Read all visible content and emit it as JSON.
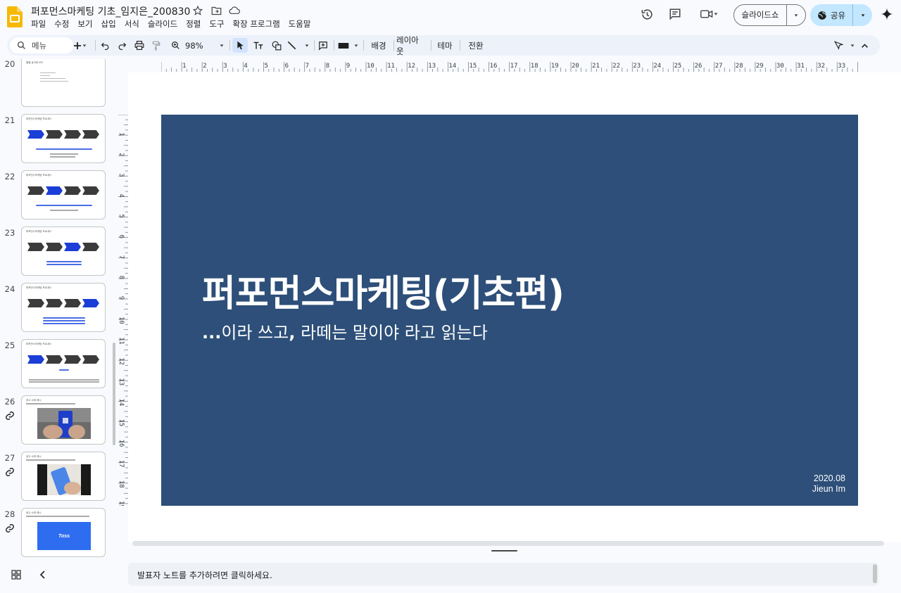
{
  "app": {
    "doc_title": "퍼포먼스마케팅 기초_임지은_200830",
    "menu": [
      "파일",
      "수정",
      "보기",
      "삽입",
      "서식",
      "슬라이드",
      "정렬",
      "도구",
      "확장 프로그램",
      "도움말"
    ],
    "slideshow_label": "슬라이드쇼",
    "share_label": "공유",
    "brand_color": "#f6b900",
    "share_color": "#c2e7ff"
  },
  "toolbar": {
    "search_label": "메뉴",
    "zoom": "98%",
    "background_label": "배경",
    "layout_label": "레이아웃",
    "theme_label": "테마",
    "transition_label": "전환"
  },
  "filmstrip": {
    "numbers": [
      "20",
      "21",
      "22",
      "23",
      "24",
      "25",
      "26",
      "27",
      "28"
    ],
    "thumb_title_20": "월별 광고비 KPI",
    "thumb_title_21": "퍼포먼스마케팅 프로세스",
    "thumb_title_26": "광고 소재 예시",
    "thumb_28_text": "Toss"
  },
  "slide": {
    "title": "퍼포먼스마케팅(기초편)",
    "subtitle_prefix": "...",
    "subtitle_mid": "이라 쓰고",
    "subtitle_comma": ",",
    "subtitle_rest": " 라떼는 말이야 라고 읽는다",
    "date": "2020.08",
    "author": "Jieun Im",
    "background_color": "#2d4f79"
  },
  "notes": {
    "placeholder": "발표자 노트를 추가하려면 클릭하세요."
  }
}
